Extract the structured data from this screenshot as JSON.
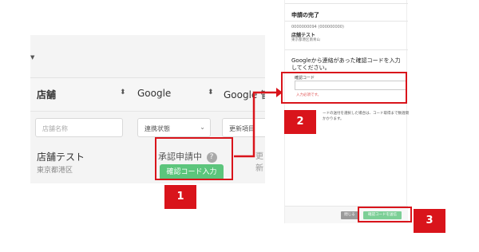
{
  "table": {
    "headers": {
      "store": "店舗",
      "google": "Google",
      "google_cut": "Google 管"
    },
    "filters": {
      "store_placeholder": "店舗名称",
      "link_status": "連携状態",
      "update_item": "更新項目"
    },
    "row": {
      "store_name": "店舗テスト",
      "area": "東京都港区",
      "status": "承認申請中",
      "help": "?",
      "cut_text": "更新",
      "confirm_button": "確認コード入力"
    }
  },
  "dialog": {
    "title": "申請の完了",
    "id_line": "0000000094 (000000000)",
    "store_name": "店舗テスト",
    "address": "東京都港区南青山",
    "question": "Googleから連絡があった確認コードを入力してください。",
    "code_label": "確認コード",
    "code_value": "",
    "required_msg": "入力必須です。",
    "note": "ードの送付を選択した場合は、コード取得まで数週間かかります。",
    "close_button": "閉じる",
    "confirm_button": "確認コードを送信"
  },
  "annotations": {
    "step1": "1",
    "step2": "2",
    "step3": "3",
    "color": "#d9141b"
  },
  "colors": {
    "accent_green": "#5cc57c",
    "panel_bg": "#f4f4f4"
  }
}
